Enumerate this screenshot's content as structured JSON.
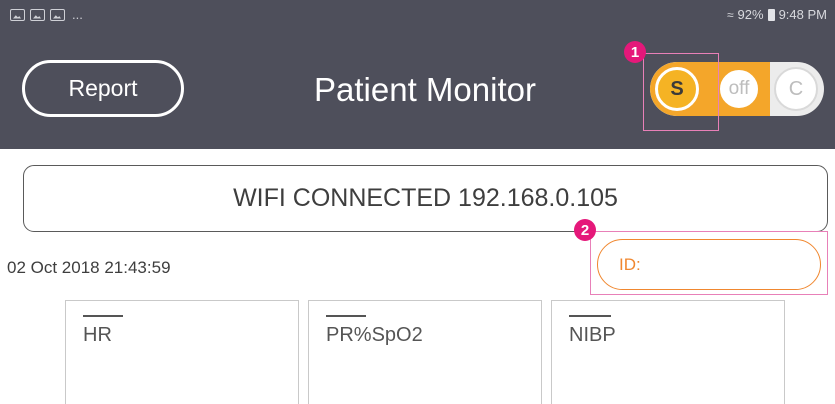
{
  "status_bar": {
    "left_icons": [
      "image-icon",
      "image-icon",
      "image-icon"
    ],
    "more": "...",
    "wifi_icon": "wifi-icon",
    "battery_percent": "92%",
    "battery_icon": "battery-icon",
    "time": "9:48 PM"
  },
  "header": {
    "report_label": "Report",
    "title": "Patient Monitor",
    "mode_toggle": {
      "options": [
        "S",
        "off",
        "C"
      ],
      "selected": "S"
    }
  },
  "annotations": {
    "marker_1": "1",
    "marker_2": "2"
  },
  "connection": {
    "status_text": "WIFI CONNECTED 192.168.0.105"
  },
  "datetime": "02 Oct 2018 21:43:59",
  "id_field": {
    "label": "ID:"
  },
  "vitals": [
    {
      "label": "HR"
    },
    {
      "label": "PR%SpO2"
    },
    {
      "label": "NIBP"
    }
  ],
  "colors": {
    "header_bg": "#4e4f5b",
    "accent_orange": "#f0872f",
    "toggle_yellow": "#f5b324",
    "marker_pink": "#e5187a"
  }
}
